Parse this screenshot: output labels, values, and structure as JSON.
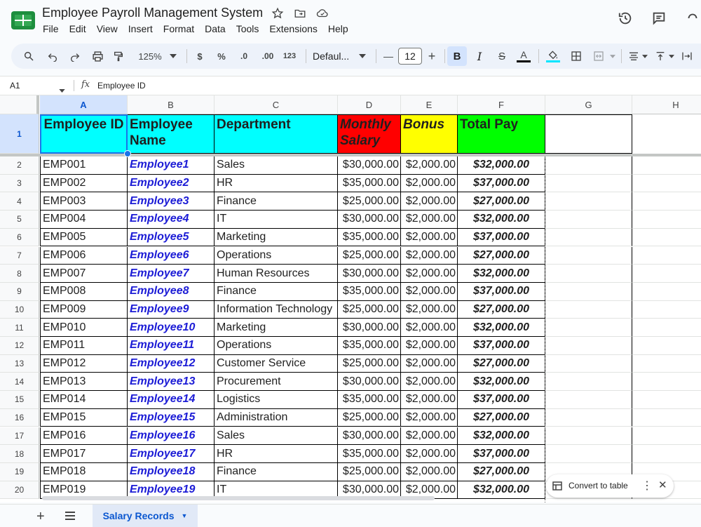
{
  "app": {
    "title": "Employee Payroll Management System",
    "menu": [
      "File",
      "Edit",
      "View",
      "Insert",
      "Format",
      "Data",
      "Tools",
      "Extensions",
      "Help"
    ]
  },
  "toolbar": {
    "zoom": "125%",
    "currency": "$",
    "percent": "%",
    "dec_decrease": ".0",
    "dec_increase": ".00",
    "number_format": "123",
    "font": "Defaul...",
    "font_size": "12",
    "minus": "—",
    "plus": "+",
    "bold": "B",
    "italic": "I",
    "strike": "S",
    "text_color": "A",
    "accent_color": "#0b57d0"
  },
  "formula_bar": {
    "name_box": "A1",
    "fx": "fx",
    "content": "Employee ID"
  },
  "grid": {
    "columns": [
      "A",
      "B",
      "C",
      "D",
      "E",
      "F",
      "G",
      "H"
    ],
    "selected_column": "A",
    "header_row_number": "1",
    "headers": [
      {
        "text": "Employee ID",
        "bg": "#00ffff"
      },
      {
        "text": "Employee Name",
        "bg": "#00ffff"
      },
      {
        "text": "Department",
        "bg": "#00ffff"
      },
      {
        "text": "Monthly Salary",
        "bg": "#ff0000"
      },
      {
        "text": "Bonus",
        "bg": "#ffff00"
      },
      {
        "text": "Total Pay",
        "bg": "#00ff00"
      }
    ],
    "rows": [
      {
        "num": "2",
        "id": "EMP001",
        "name": "Employee1",
        "dept": "Sales",
        "salary": "$30,000.00",
        "bonus": "$2,000.00",
        "total": "$32,000.00"
      },
      {
        "num": "3",
        "id": "EMP002",
        "name": "Employee2",
        "dept": "HR",
        "salary": "$35,000.00",
        "bonus": "$2,000.00",
        "total": "$37,000.00"
      },
      {
        "num": "4",
        "id": "EMP003",
        "name": "Employee3",
        "dept": "Finance",
        "salary": "$25,000.00",
        "bonus": "$2,000.00",
        "total": "$27,000.00"
      },
      {
        "num": "5",
        "id": "EMP004",
        "name": "Employee4",
        "dept": "IT",
        "salary": "$30,000.00",
        "bonus": "$2,000.00",
        "total": "$32,000.00"
      },
      {
        "num": "6",
        "id": "EMP005",
        "name": "Employee5",
        "dept": "Marketing",
        "salary": "$35,000.00",
        "bonus": "$2,000.00",
        "total": "$37,000.00"
      },
      {
        "num": "7",
        "id": "EMP006",
        "name": "Employee6",
        "dept": "Operations",
        "salary": "$25,000.00",
        "bonus": "$2,000.00",
        "total": "$27,000.00"
      },
      {
        "num": "8",
        "id": "EMP007",
        "name": "Employee7",
        "dept": "Human Resources",
        "salary": "$30,000.00",
        "bonus": "$2,000.00",
        "total": "$32,000.00"
      },
      {
        "num": "9",
        "id": "EMP008",
        "name": "Employee8",
        "dept": "Finance",
        "salary": "$35,000.00",
        "bonus": "$2,000.00",
        "total": "$37,000.00"
      },
      {
        "num": "10",
        "id": "EMP009",
        "name": "Employee9",
        "dept": "Information Technology",
        "salary": "$25,000.00",
        "bonus": "$2,000.00",
        "total": "$27,000.00"
      },
      {
        "num": "11",
        "id": "EMP010",
        "name": "Employee10",
        "dept": "Marketing",
        "salary": "$30,000.00",
        "bonus": "$2,000.00",
        "total": "$32,000.00"
      },
      {
        "num": "12",
        "id": "EMP011",
        "name": "Employee11",
        "dept": "Operations",
        "salary": "$35,000.00",
        "bonus": "$2,000.00",
        "total": "$37,000.00"
      },
      {
        "num": "13",
        "id": "EMP012",
        "name": "Employee12",
        "dept": "Customer Service",
        "salary": "$25,000.00",
        "bonus": "$2,000.00",
        "total": "$27,000.00"
      },
      {
        "num": "14",
        "id": "EMP013",
        "name": "Employee13",
        "dept": "Procurement",
        "salary": "$30,000.00",
        "bonus": "$2,000.00",
        "total": "$32,000.00"
      },
      {
        "num": "15",
        "id": "EMP014",
        "name": "Employee14",
        "dept": "Logistics",
        "salary": "$35,000.00",
        "bonus": "$2,000.00",
        "total": "$37,000.00"
      },
      {
        "num": "16",
        "id": "EMP015",
        "name": "Employee15",
        "dept": "Administration",
        "salary": "$25,000.00",
        "bonus": "$2,000.00",
        "total": "$27,000.00"
      },
      {
        "num": "17",
        "id": "EMP016",
        "name": "Employee16",
        "dept": "Sales",
        "salary": "$30,000.00",
        "bonus": "$2,000.00",
        "total": "$32,000.00"
      },
      {
        "num": "18",
        "id": "EMP017",
        "name": "Employee17",
        "dept": "HR",
        "salary": "$35,000.00",
        "bonus": "$2,000.00",
        "total": "$37,000.00"
      },
      {
        "num": "19",
        "id": "EMP018",
        "name": "Employee18",
        "dept": "Finance",
        "salary": "$25,000.00",
        "bonus": "$2,000.00",
        "total": "$27,000.00"
      },
      {
        "num": "20",
        "id": "EMP019",
        "name": "Employee19",
        "dept": "IT",
        "salary": "$30,000.00",
        "bonus": "$2,000.00",
        "total": "$32,000.00"
      }
    ]
  },
  "bottom": {
    "sheet_tab": "Salary Records"
  },
  "chip": {
    "label": "Convert to table"
  }
}
